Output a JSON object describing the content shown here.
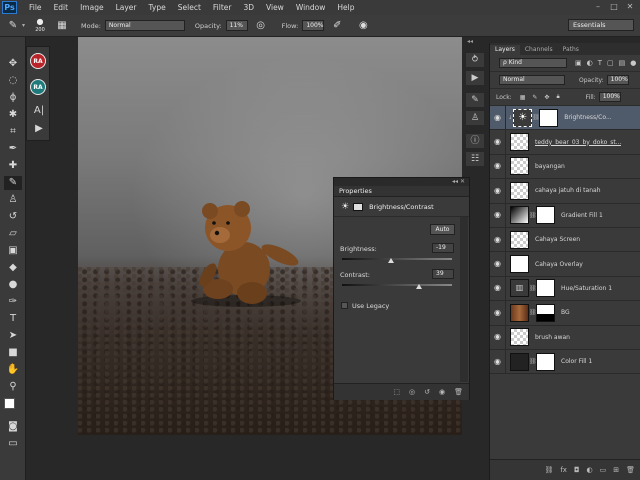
{
  "menubar": {
    "logo": "Ps",
    "items": [
      "File",
      "Edit",
      "Image",
      "Layer",
      "Type",
      "Select",
      "Filter",
      "3D",
      "View",
      "Window",
      "Help"
    ]
  },
  "options": {
    "brush_size": "200",
    "mode_label": "Mode:",
    "mode_value": "Normal",
    "opacity_label": "Opacity:",
    "opacity_value": "11%",
    "flow_label": "Flow:",
    "flow_value": "100%",
    "workspace": "Essentials"
  },
  "tools_extra": {
    "ra1": "RA",
    "ra2": "RA"
  },
  "layers_panel": {
    "tabs": [
      "Layers",
      "Channels",
      "Paths"
    ],
    "kind_label": "ρ Kind",
    "blend_mode": "Normal",
    "opacity_label": "Opacity:",
    "opacity_value": "100%",
    "lock_label": "Lock:",
    "fill_label": "Fill:",
    "fill_value": "100%",
    "layers": [
      {
        "name": "Brightness/Co...",
        "selected": true,
        "type": "adjust-brightness"
      },
      {
        "name": "teddy_bear_03_by_doko_st...",
        "selected": false,
        "type": "checker"
      },
      {
        "name": "bayangan",
        "selected": false,
        "type": "checker"
      },
      {
        "name": "cahaya jatuh di tanah",
        "selected": false,
        "type": "checker"
      },
      {
        "name": "Gradient Fill 1",
        "selected": false,
        "type": "gradient"
      },
      {
        "name": "Cahaya Screen",
        "selected": false,
        "type": "checker"
      },
      {
        "name": "Cahaya Overlay",
        "selected": false,
        "type": "white"
      },
      {
        "name": "Hue/Saturation 1",
        "selected": false,
        "type": "hue"
      },
      {
        "name": "BG",
        "selected": false,
        "type": "photo"
      },
      {
        "name": "brush awan",
        "selected": false,
        "type": "checker"
      },
      {
        "name": "Color Fill 1",
        "selected": false,
        "type": "colorfill"
      }
    ]
  },
  "properties": {
    "title": "Properties",
    "header": "Brightness/Contrast",
    "auto_label": "Auto",
    "brightness_label": "Brightness:",
    "brightness_value": "-19",
    "contrast_label": "Contrast:",
    "contrast_value": "39",
    "legacy_label": "Use Legacy",
    "legacy_checked": false
  },
  "colors": {
    "accent": "#4f5a6a",
    "ps_blue": "#4ea6ff",
    "ra_red": "#b8242a",
    "ra_teal": "#1f7b7b"
  }
}
